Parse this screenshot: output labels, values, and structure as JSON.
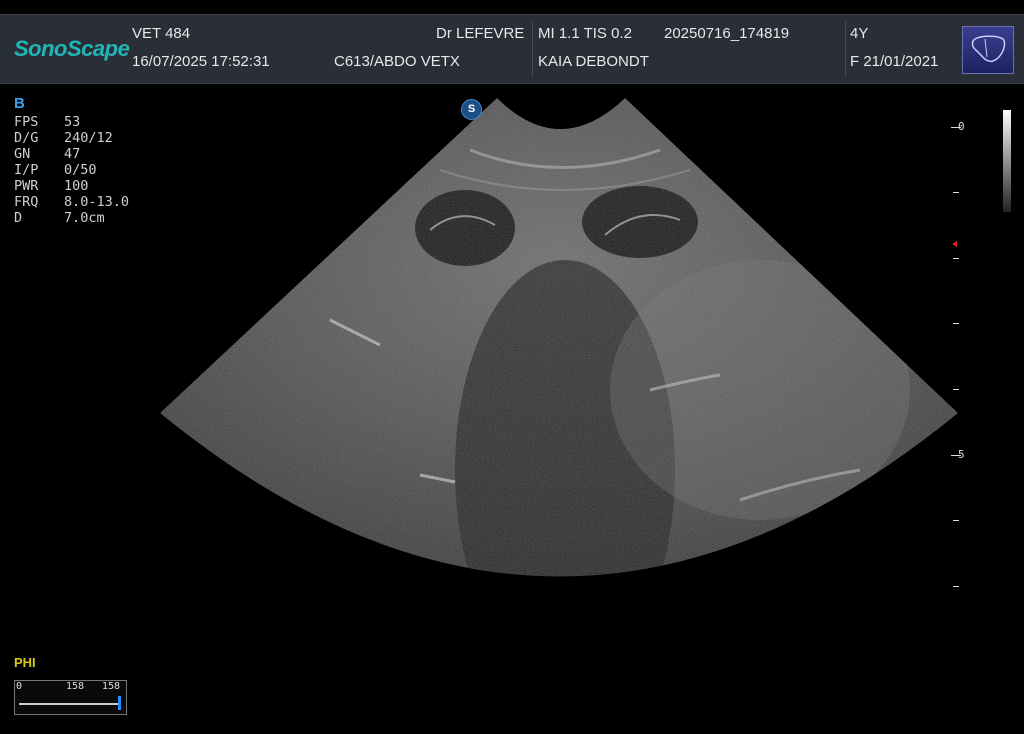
{
  "header": {
    "brand": "SonoScape",
    "facility": "VET 484",
    "datetime": "16/07/2025 17:52:31",
    "doctor": "Dr LEFEVRE",
    "probe_preset": "C613/ABDO VETX",
    "mi_tis": "MI  1.1   TIS 0.2",
    "exam_id": "20250716_174819",
    "patient_name": "KAIA DEBONDT",
    "age": "4Y",
    "sex_dob": "F   21/01/2021",
    "organ_icon": "liver-icon"
  },
  "imaging": {
    "mode": "B",
    "params": [
      {
        "key": "FPS",
        "value": "53"
      },
      {
        "key": "D/G",
        "value": "240/12"
      },
      {
        "key": "GN",
        "value": "47"
      },
      {
        "key": "I/P",
        "value": "0/50"
      },
      {
        "key": "PWR",
        "value": "100"
      },
      {
        "key": "FRQ",
        "value": "8.0-13.0"
      },
      {
        "key": "D",
        "value": "7.0cm"
      }
    ],
    "probe_marker": "S"
  },
  "depth_scale": {
    "label_0": "0",
    "label_5": "5"
  },
  "phi": {
    "label": "PHI",
    "min": "0",
    "mid": "158",
    "max": "158"
  },
  "colors": {
    "brand": "#1fb6b8",
    "header_bg": "#2a2e36",
    "mode": "#3aa0e8",
    "phi": "#d8c81e",
    "focus": "#e02020"
  }
}
